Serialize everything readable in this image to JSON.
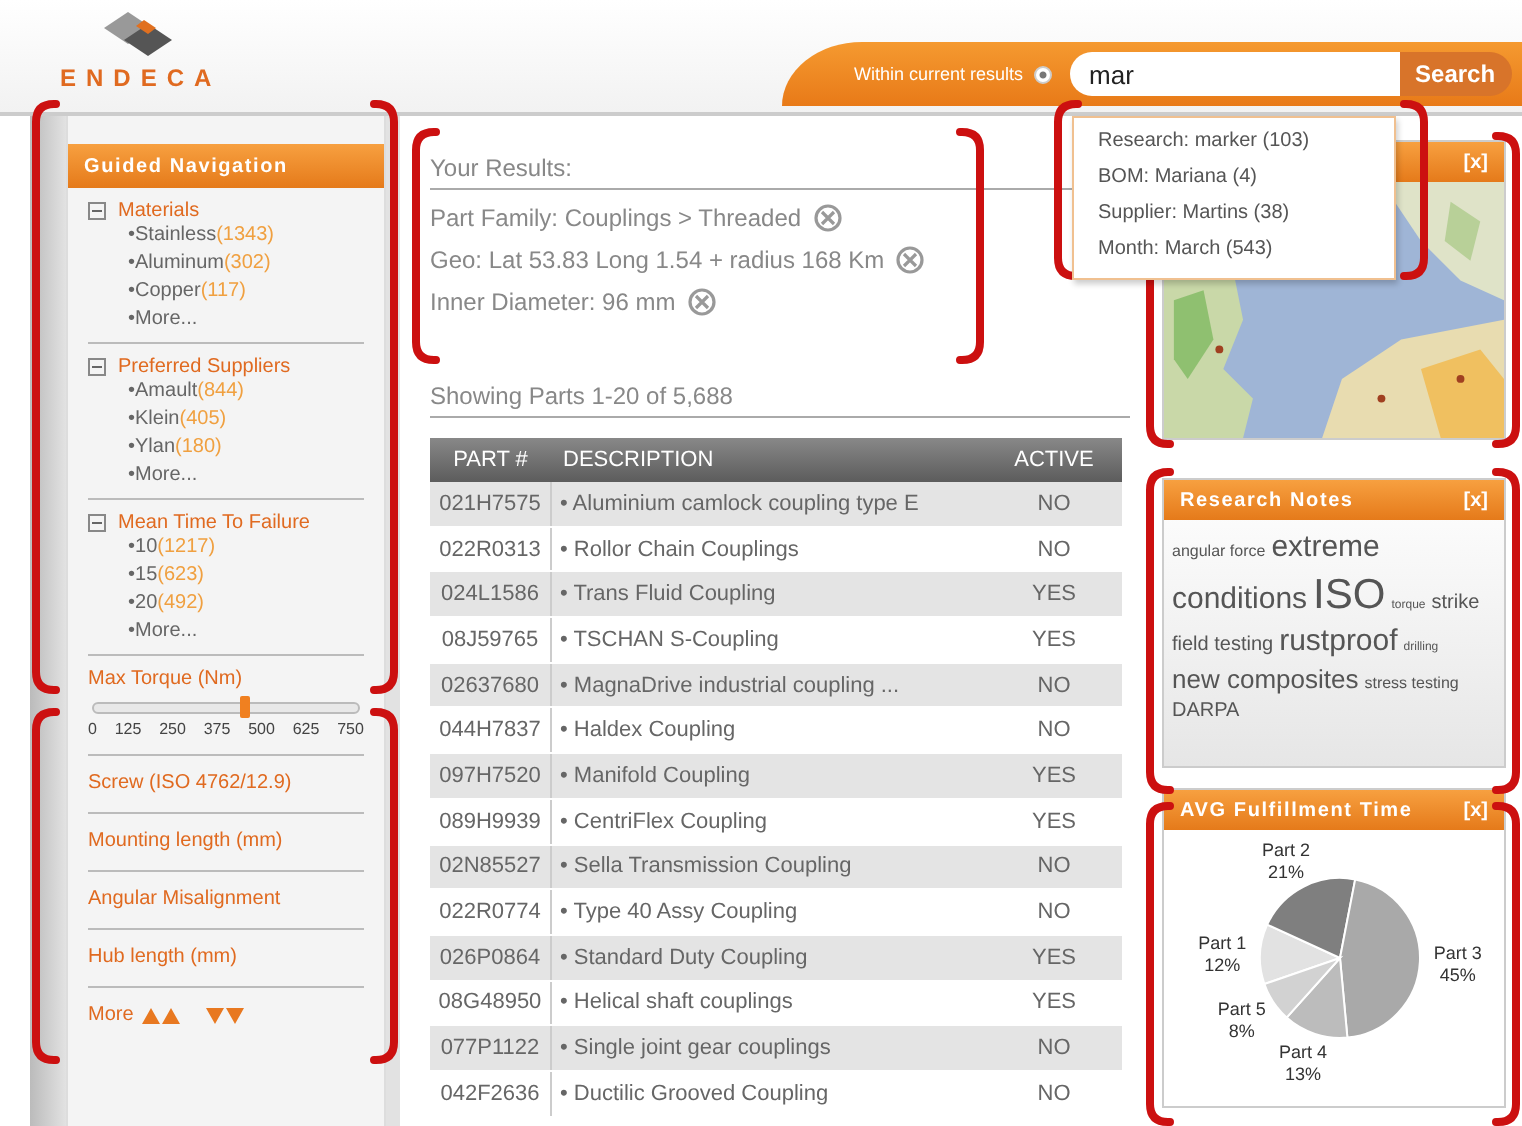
{
  "header": {
    "logo": "ENDECA",
    "search": {
      "scope_label": "Within current results",
      "scope_selected": true,
      "value": "mar",
      "button": "Search"
    },
    "suggestions": [
      "Research: marker (103)",
      "BOM: Mariana (4)",
      "Supplier: Martins (38)",
      "Month: March (543)"
    ]
  },
  "guided_navigation": {
    "title": "Guided Navigation",
    "groups": [
      {
        "title": "Materials",
        "expanded": true,
        "items": [
          {
            "label": "•Stainless",
            "count": "(1343)"
          },
          {
            "label": "•Aluminum",
            "count": "(302)"
          },
          {
            "label": "•Copper",
            "count": "(117)"
          },
          {
            "label": "•More..."
          }
        ]
      },
      {
        "title": "Preferred Suppliers",
        "expanded": true,
        "items": [
          {
            "label": "•Amault",
            "count": "(844)"
          },
          {
            "label": "•Klein",
            "count": "(405)"
          },
          {
            "label": "•Ylan",
            "count": "(180)"
          },
          {
            "label": "•More..."
          }
        ]
      },
      {
        "title": "Mean Time To Failure",
        "expanded": true,
        "items": [
          {
            "label": "•10",
            "count": "(1217)"
          },
          {
            "label": "•15",
            "count": "(623)"
          },
          {
            "label": "•20",
            "count": "(492)"
          },
          {
            "label": "•More..."
          }
        ]
      }
    ]
  },
  "filters": {
    "slider": {
      "label": "Max Torque (Nm)",
      "level": 0.57,
      "ticks": [
        "0",
        "125",
        "250",
        "375",
        "500",
        "625",
        "750"
      ]
    },
    "links": [
      "Screw (ISO 4762/12.9)",
      "Mounting length (mm)",
      "Angular Misalignment",
      "Hub length (mm)"
    ],
    "more": "More"
  },
  "results": {
    "title": "Your Results:",
    "breadcrumbs": [
      "Part Family: Couplings > Threaded",
      "Geo: Lat 53.83 Long 1.54 + radius 168 Km",
      "Inner Diameter: 96 mm"
    ],
    "summary": "Showing Parts 1-20 of 5,688"
  },
  "table": {
    "columns": [
      "PART #",
      "DESCRIPTION",
      "ACTIVE"
    ],
    "rows": [
      [
        "021H7575",
        "• Aluminium camlock coupling type E",
        "NO"
      ],
      [
        "022R0313",
        "• Rollor Chain Couplings",
        "NO"
      ],
      [
        "024L1586",
        "• Trans Fluid Coupling",
        "YES"
      ],
      [
        "08J59765",
        "• TSCHAN S-Coupling",
        "YES"
      ],
      [
        "02637680",
        "• MagnaDrive industrial coupling ...",
        "NO"
      ],
      [
        "044H7837",
        "• Haldex Coupling",
        "NO"
      ],
      [
        "097H7520",
        "• Manifold Coupling",
        "YES"
      ],
      [
        "089H9939",
        "• CentriFlex Coupling",
        "YES"
      ],
      [
        "02N85527",
        "• Sella Transmission Coupling",
        "NO"
      ],
      [
        "022R0774",
        "• Type 40 Assy Coupling",
        "NO"
      ],
      [
        "026P0864",
        "• Standard Duty Coupling",
        "YES"
      ],
      [
        "08G48950",
        "• Helical shaft couplings",
        "YES"
      ],
      [
        "077P1122",
        "• Single joint gear couplings",
        "NO"
      ],
      [
        "042F2636",
        "• Ductilic Grooved Coupling",
        "NO"
      ]
    ]
  },
  "map_panel": {
    "close": "[x]"
  },
  "research_notes": {
    "title": "Research Notes",
    "close": "[x]",
    "tags": [
      {
        "text": "angular force",
        "kind": "small"
      },
      {
        "text": "extreme",
        "kind": "large"
      },
      {
        "text": "conditions",
        "kind": "large"
      },
      {
        "text": "ISO",
        "kind": "huge"
      },
      {
        "text": "torque",
        "kind": "tiny"
      },
      {
        "text": "strike",
        "kind": "normal"
      },
      {
        "text": "field testing",
        "kind": "normal"
      },
      {
        "text": "rustproof",
        "kind": "large"
      },
      {
        "text": "drilling",
        "kind": "tiny"
      },
      {
        "text": "new composites",
        "kind": "medium"
      },
      {
        "text": "stress testing",
        "kind": "small"
      },
      {
        "text": "DARPA",
        "kind": "normal"
      }
    ]
  },
  "fulfillment": {
    "title": "AVG Fulfillment Time",
    "close": "[x]",
    "chart_data": {
      "type": "pie",
      "categories": [
        "Part 1",
        "Part 2",
        "Part 3",
        "Part 4",
        "Part 5"
      ],
      "values": [
        12,
        21,
        45,
        13,
        8
      ],
      "data_labels": true,
      "value_labels": [
        "12%",
        "21%",
        "45%",
        "13%",
        "8%"
      ]
    }
  }
}
